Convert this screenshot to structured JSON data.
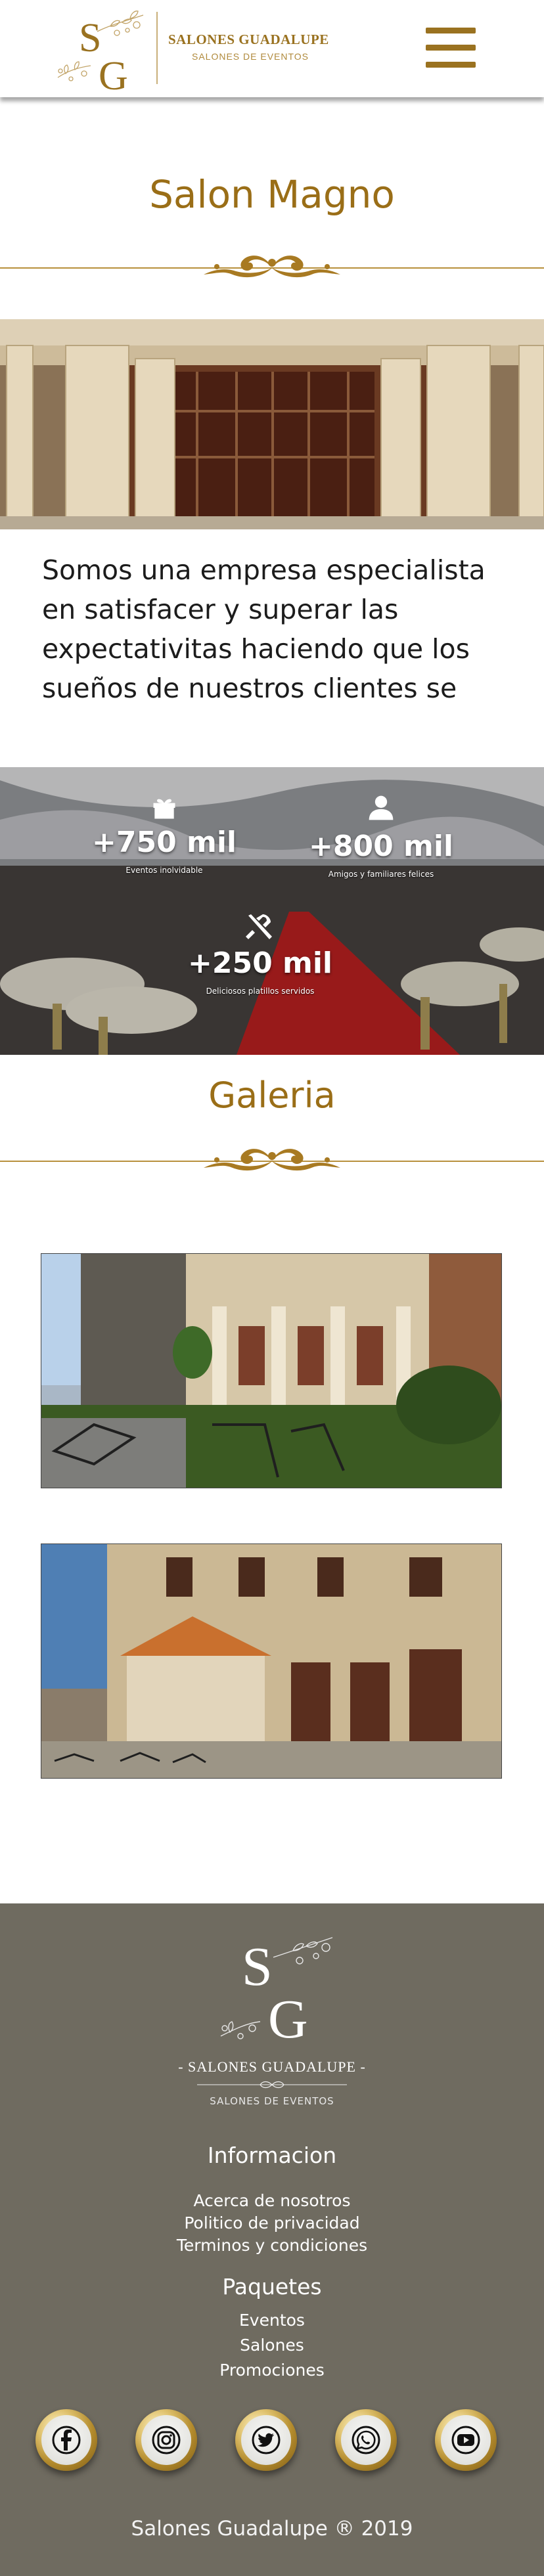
{
  "header": {
    "brand_name": "SALONES GUADALUPE",
    "brand_tagline": "SALONES DE EVENTOS",
    "monogram": "SG",
    "menu_icon": "hamburger-menu-icon"
  },
  "magno": {
    "title": "Salon Magno",
    "intro": "Somos una empresa especialista en satisfacer y superar las expectativitas haciendo que los sueños de nuestros clientes se"
  },
  "stats": [
    {
      "icon": "gift-icon",
      "value": "+750 mil",
      "caption": "Eventos inolvidable"
    },
    {
      "icon": "user-icon",
      "value": "+800 mil",
      "caption": "Amigos y familiares felices"
    },
    {
      "icon": "utensils-icon",
      "value": "+250 mil",
      "caption": "Deliciosos platillos servidos"
    }
  ],
  "gallery": {
    "title": "Galeria"
  },
  "footer": {
    "brand_name": "- SALONES GUADALUPE -",
    "brand_tagline": "SALONES DE EVENTOS",
    "info_heading": "Informacion",
    "info_links": [
      "Acerca de nosotros",
      "Politico de privacidad",
      "Terminos y condiciones"
    ],
    "packages_heading": "Paquetes",
    "package_links": [
      "Eventos",
      "Salones",
      "Promociones"
    ],
    "social": [
      "facebook-icon",
      "instagram-icon",
      "twitter-icon",
      "whatsapp-icon",
      "youtube-icon"
    ],
    "copyright": "Salones Guadalupe ® 2019"
  },
  "colors": {
    "gold": "#9a6e17",
    "footer_bg": "#6f6b60"
  }
}
